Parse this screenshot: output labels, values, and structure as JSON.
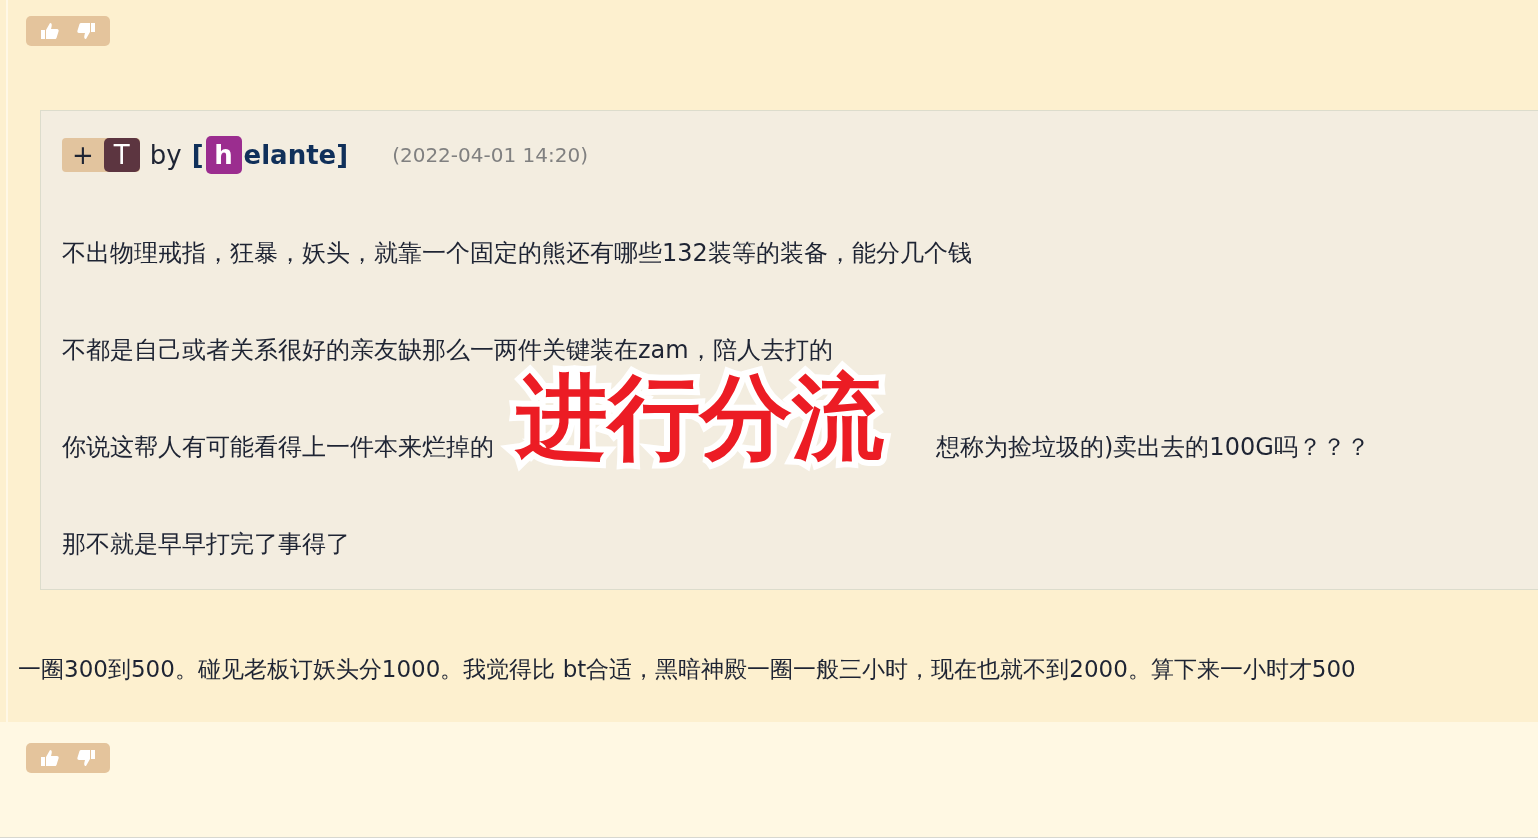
{
  "quote": {
    "badge": {
      "plus": "+",
      "letter": "T"
    },
    "by": "by",
    "author": {
      "open": "[",
      "initial": "h",
      "rest": "elante]"
    },
    "date": "(2022-04-01 14:20)",
    "lines": [
      {
        "parts": [
          "不出物理戒指，狂暴，妖头，就靠一个固定的熊还有哪些132装等的装备，能分几个钱"
        ]
      },
      {
        "parts": [
          "不都是自己或者关系很好的亲友缺那么一两件关键装在zam，陪人去打的"
        ]
      },
      {
        "parts": [
          "你说这帮人有可能看得上一件本来烂掉的",
          "想称为捡垃圾的)卖出去的100G吗？？？"
        ]
      },
      {
        "parts": [
          "那不就是早早打完了事得了"
        ]
      }
    ]
  },
  "reply_text": "一圈300到500。碰见老板订妖头分1000。我觉得比 bt合适，黑暗神殿一圈一般三小时，现在也就不到2000。算下来一小时才500",
  "overlay_caption": "进行分流"
}
